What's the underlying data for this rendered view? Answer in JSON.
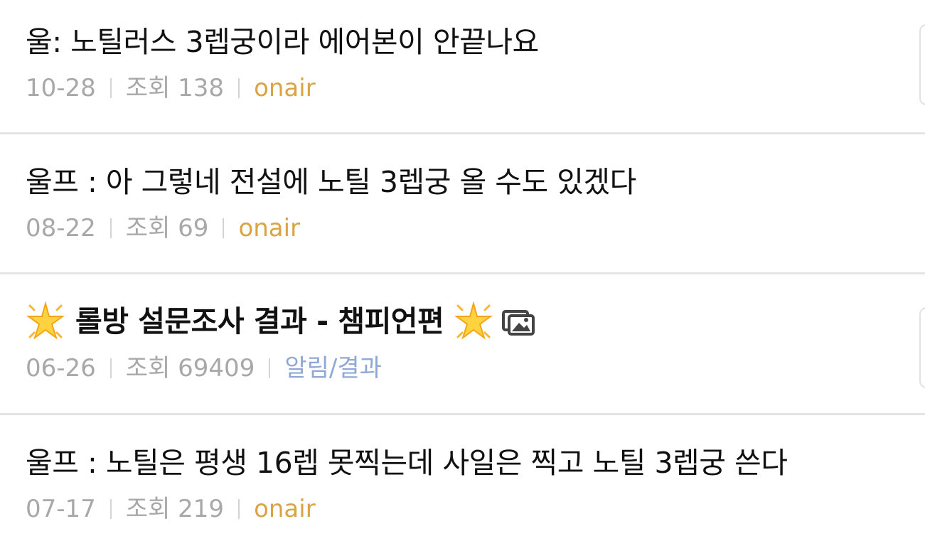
{
  "posts": [
    {
      "title": "울: 노틸러스 3렙궁이라 에어본이 안끝나요",
      "date": "10-28",
      "views": "조회 138",
      "category": "onair"
    },
    {
      "title": "울프 : 아 그렇네 전설에 노틸 3렙궁 올 수도 있겠다",
      "date": "08-22",
      "views": "조회 69",
      "category": "onair"
    },
    {
      "title": "롤방 설문조사 결과 - 챔피언편",
      "date": "06-26",
      "views": "조회 69409",
      "category": "알림/결과",
      "icons": [
        "sparkle-icon",
        "sparkle-icon",
        "image-attachment-icon"
      ]
    },
    {
      "title": "울프 : 노틸은 평생 16렙 못찍는데 사일은 찍고 노틸 3렙궁 쓴다",
      "date": "07-17",
      "views": "조회 219",
      "category": "onair"
    }
  ],
  "colors": {
    "title": "#111111",
    "meta": "#a8a8a8",
    "category_onair": "#d9a441",
    "category_notice": "#8fa8d6",
    "divider": "#e4e4e4"
  }
}
